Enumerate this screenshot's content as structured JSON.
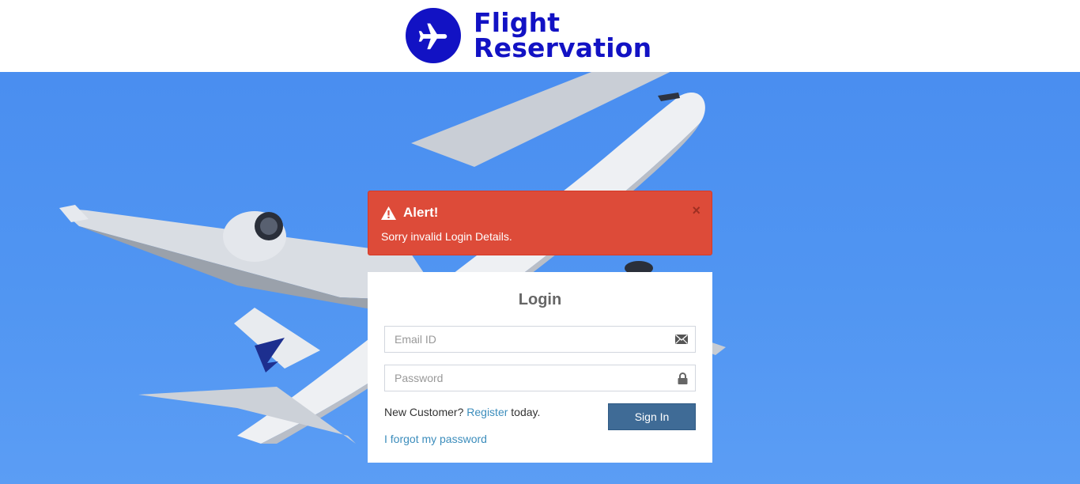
{
  "header": {
    "logo_line1": "Flight",
    "logo_line2": "Reservation",
    "brand_color": "#1212c4",
    "logo_icon": "airplane-icon"
  },
  "alert": {
    "title": "Alert!",
    "message": "Sorry invalid Login Details.",
    "close_label": "×",
    "color": "#dd4b39",
    "icon": "warning-icon"
  },
  "login": {
    "title": "Login",
    "email": {
      "placeholder": "Email ID",
      "value": "",
      "icon": "envelope-icon"
    },
    "password": {
      "placeholder": "Password",
      "value": "",
      "icon": "lock-icon"
    },
    "new_customer_text": "New Customer?",
    "register_link": "Register",
    "today_text": "today.",
    "forgot_link": "I forgot my password",
    "signin_label": "Sign In",
    "button_color": "#3f6b96"
  }
}
